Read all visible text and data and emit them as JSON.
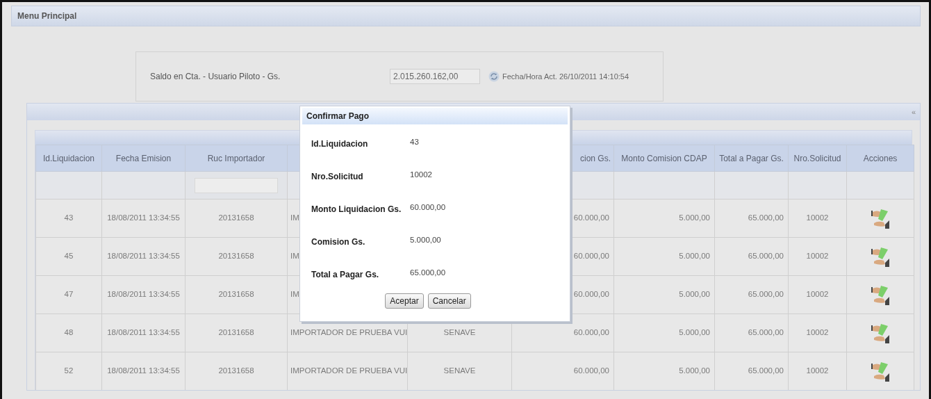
{
  "header": {
    "title": "Menu Principal"
  },
  "balance": {
    "label": "Saldo en Cta. - Usuario Piloto - Gs.",
    "value": "2.015.260.162,00",
    "timestamp": "Fecha/Hora Act. 26/10/2011 14:10:54"
  },
  "grid": {
    "collapse": "«",
    "columns": [
      {
        "label": "Id.Liquidacion",
        "filter": false
      },
      {
        "label": "Fecha Emision",
        "filter": false
      },
      {
        "label": "Ruc Importador",
        "filter": true
      },
      {},
      {},
      {
        "label": "cion Gs.",
        "filter": false
      },
      {
        "label": "Monto Comision CDAP",
        "filter": false
      },
      {
        "label": "Total a Pagar Gs.",
        "filter": false
      },
      {
        "label": "Nro.Solicitud",
        "filter": false
      },
      {
        "label": "Acciones",
        "filter": false
      }
    ],
    "rows": [
      {
        "cells": [
          "43",
          "18/08/2011 13:34:55",
          "20131658",
          "IM",
          null,
          "60.000,00",
          "5.000,00",
          "65.000,00",
          "10002"
        ]
      },
      {
        "cells": [
          "45",
          "18/08/2011 13:34:55",
          "20131658",
          "IM",
          null,
          "60.000,00",
          "5.000,00",
          "65.000,00",
          "10002"
        ]
      },
      {
        "cells": [
          "47",
          "18/08/2011 13:34:55",
          "20131658",
          "IM",
          null,
          "60.000,00",
          "5.000,00",
          "65.000,00",
          "10002"
        ]
      },
      {
        "cells": [
          "48",
          "18/08/2011 13:34:55",
          "20131658",
          "IMPORTADOR DE PRUEBA VUI",
          "SENAVE",
          "60.000,00",
          "5.000,00",
          "65.000,00",
          "10002"
        ]
      },
      {
        "cells": [
          "52",
          "18/08/2011 13:34:55",
          "20131658",
          "IMPORTADOR DE PRUEBA VUI",
          "SENAVE",
          "60.000,00",
          "5.000,00",
          "65.000,00",
          "10002"
        ]
      }
    ]
  },
  "dialog": {
    "title": "Confirmar Pago",
    "fields": [
      {
        "label": "Id.Liquidacion",
        "value": "43"
      },
      {
        "label": "Nro.Solicitud",
        "value": "10002"
      },
      {
        "label": "Monto Liquidacion Gs.",
        "value": "60.000,00"
      },
      {
        "label": "Comision Gs.",
        "value": "5.000,00"
      },
      {
        "label": "Total a Pagar Gs.",
        "value": "65.000,00"
      }
    ],
    "buttons": [
      "Aceptar",
      "Cancelar"
    ]
  }
}
